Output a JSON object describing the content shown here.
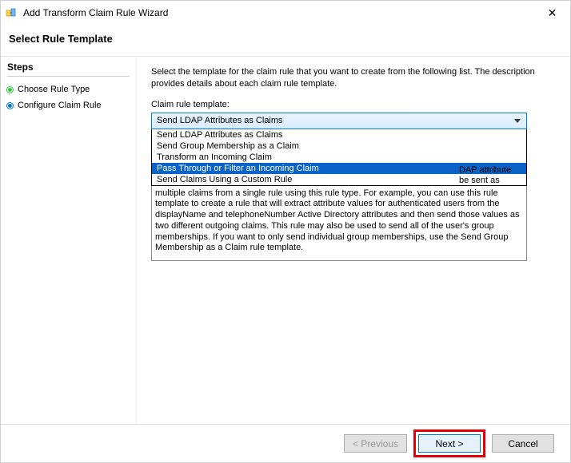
{
  "window": {
    "title": "Add Transform Claim Rule Wizard",
    "close_glyph": "✕"
  },
  "page": {
    "heading": "Select Rule Template"
  },
  "sidebar": {
    "heading": "Steps",
    "items": [
      {
        "label": "Choose Rule Type",
        "bullet_color": "#2ecc40"
      },
      {
        "label": "Configure Claim Rule",
        "bullet_color": "#0078d7"
      }
    ]
  },
  "main": {
    "instruction": "Select the template for the claim rule that you want to create from the following list. The description provides details about each claim rule template.",
    "combo_label": "Claim rule template:",
    "combo_value": "Send LDAP Attributes as Claims",
    "dropdown_options": [
      "Send LDAP Attributes as Claims",
      "Send Group Membership as a Claim",
      "Transform an Incoming Claim",
      "Pass Through or Filter an Incoming Claim",
      "Send Claims Using a Custom Rule"
    ],
    "dropdown_highlight_index": 3,
    "desc_right_frag_1": "DAP attribute",
    "desc_right_frag_2": "be sent as",
    "desc_body": "multiple claims from a single rule using this rule type. For example, you can use this rule template to create a rule that will extract attribute values for authenticated users from the displayName and telephoneNumber Active Directory attributes and then send those values as two different outgoing claims. This rule may also be used to send all of the user's group memberships. If you want to only send individual group memberships, use the Send Group Membership as a Claim rule template."
  },
  "buttons": {
    "prev": "< Previous",
    "next": "Next >",
    "cancel": "Cancel"
  }
}
